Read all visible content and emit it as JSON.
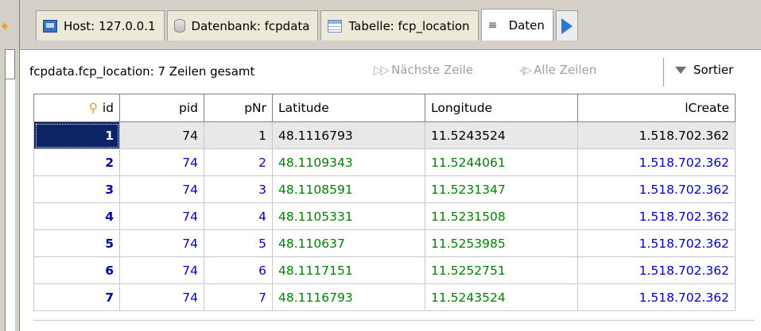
{
  "tabs": [
    {
      "label": "Host: 127.0.0.1",
      "icon": "host-icon"
    },
    {
      "label": "Datenbank: fcpdata",
      "icon": "database-icon"
    },
    {
      "label": "Tabelle: fcp_location",
      "icon": "table-icon"
    },
    {
      "label": "Daten",
      "icon": "data-icon",
      "active": true
    }
  ],
  "toolbar": {
    "row_count": "fcpdata.fcp_location: 7 Zeilen gesamt",
    "next_row": "Nächste Zeile",
    "all_rows": "Alle Zeilen",
    "sort": "Sortier"
  },
  "grid": {
    "columns": [
      "id",
      "pid",
      "pNr",
      "Latitude",
      "Longitude",
      "lCreate"
    ],
    "rows": [
      [
        "1",
        "74",
        "1",
        "48.1116793",
        "11.5243524",
        "1.518.702.362"
      ],
      [
        "2",
        "74",
        "2",
        "48.1109343",
        "11.5244061",
        "1.518.702.362"
      ],
      [
        "3",
        "74",
        "3",
        "48.1108591",
        "11.5231347",
        "1.518.702.362"
      ],
      [
        "4",
        "74",
        "4",
        "48.1105331",
        "11.5231508",
        "1.518.702.362"
      ],
      [
        "5",
        "74",
        "5",
        "48.110637",
        "11.5253985",
        "1.518.702.362"
      ],
      [
        "6",
        "74",
        "6",
        "48.1117151",
        "11.5252751",
        "1.518.702.362"
      ],
      [
        "7",
        "74",
        "7",
        "48.1116793",
        "11.5243524",
        "1.518.702.362"
      ]
    ]
  },
  "colors": {
    "id": "#0000a0",
    "integer": "#0000c8",
    "real": "#008000",
    "focus": "#0a2466"
  }
}
